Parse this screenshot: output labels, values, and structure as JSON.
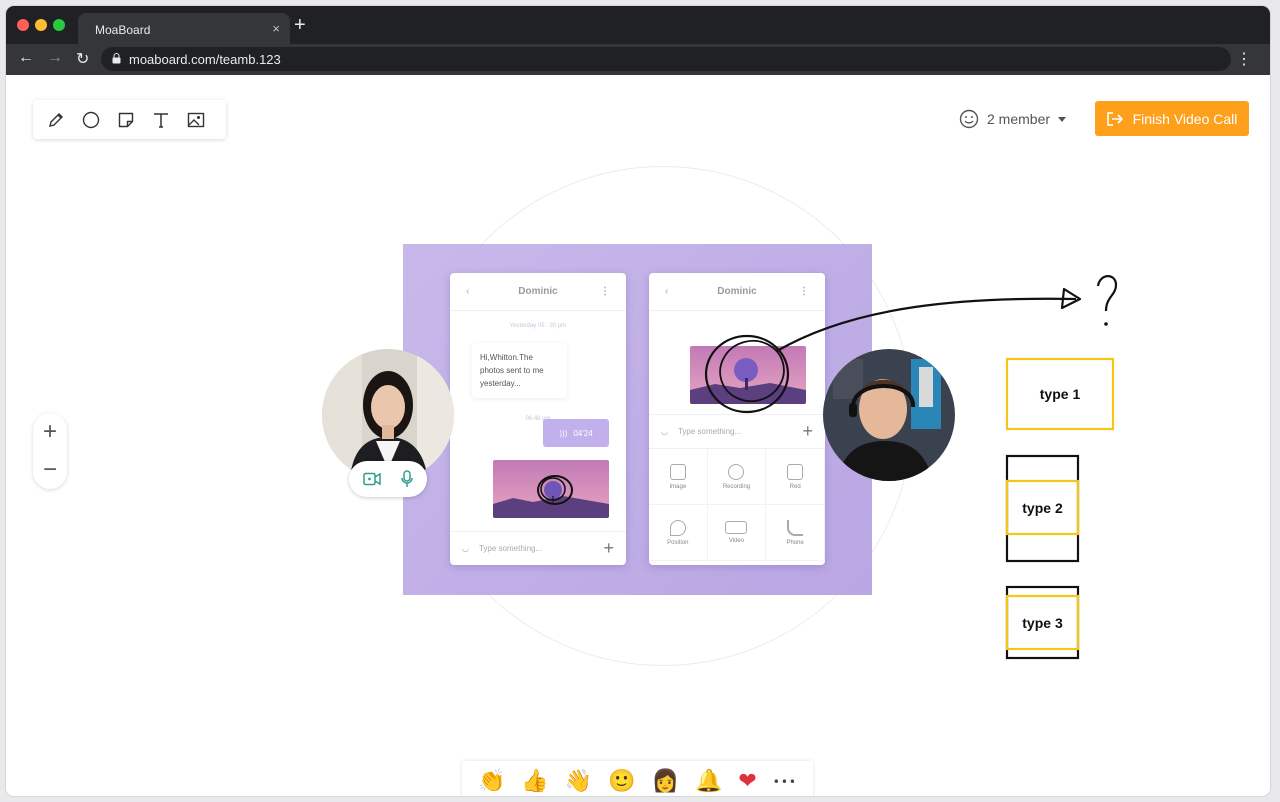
{
  "browser": {
    "tab_title": "MoaBoard",
    "tab_close": "×",
    "new_tab": "+",
    "url": "moaboard.com/teamb.123",
    "traffic_colors": [
      "#ff5f57",
      "#febc2e",
      "#28c840"
    ]
  },
  "toolbar": {
    "tools": [
      "pencil-icon",
      "circle-icon",
      "sticky-note-icon",
      "text-icon",
      "image-icon"
    ]
  },
  "header": {
    "members_label": "2 member",
    "finish_label": "Finish Video Call",
    "accent_color": "#ffa01c"
  },
  "zoom": {
    "plus": "+",
    "minus": "−"
  },
  "mockup": {
    "left_phone": {
      "name": "Dominic",
      "meta_top": "Yesterday 05 : 30 pm",
      "message": "Hi,Whitton.The photos sent to me yesterday...",
      "meta_mid": "06:48 pm",
      "voice": "04'24",
      "placeholder": "Type something..."
    },
    "right_phone": {
      "name": "Dominic",
      "placeholder": "Type something...",
      "grid": [
        "Image",
        "Recording",
        "Red",
        "Position",
        "Video",
        "Phone"
      ]
    }
  },
  "whiteboard": {
    "question_mark": "?",
    "boxes": [
      "type 1",
      "type 2",
      "type 3"
    ],
    "box_color": "#f5c518"
  },
  "reactions": {
    "emojis": [
      "👏",
      "👍",
      "👋",
      "🙂",
      "👩",
      "🔔",
      "❤"
    ],
    "more": "•••"
  }
}
